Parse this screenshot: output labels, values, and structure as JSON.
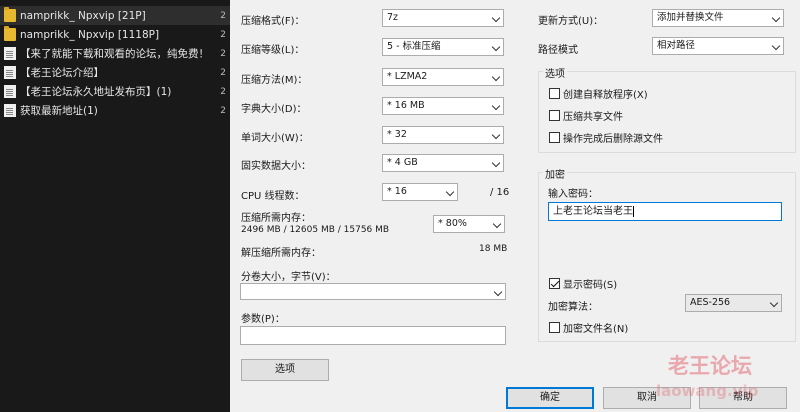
{
  "file_list": [
    {
      "name": "namprikk_ Npxvip [21P]",
      "extra": "2",
      "icon": "folder-icon"
    },
    {
      "name": "namprikk_ Npxvip [1118P]",
      "extra": "2",
      "icon": "folder-icon"
    },
    {
      "name": "【来了就能下载和观看的论坛，纯免费！",
      "extra": "2",
      "icon": "document-icon"
    },
    {
      "name": "【老王论坛介绍】",
      "extra": "2",
      "icon": "document-icon"
    },
    {
      "name": "【老王论坛永久地址发布页】(1)",
      "extra": "2",
      "icon": "document-icon"
    },
    {
      "name": "获取最新地址(1)",
      "extra": "2",
      "icon": "document-icon"
    }
  ],
  "form": {
    "archive_format_label": "压缩格式(F)：",
    "archive_format_value": "7z",
    "compression_level_label": "压缩等级(L)：",
    "compression_level_value": "5 - 标准压缩",
    "compression_method_label": "压缩方法(M)：",
    "compression_method_value": "* LZMA2",
    "dictionary_size_label": "字典大小(D)：",
    "dictionary_size_value": "* 16 MB",
    "word_size_label": "单词大小(W)：",
    "word_size_value": "* 32",
    "solid_block_label": "固实数据大小：",
    "solid_block_value": "* 4 GB",
    "cpu_threads_label": "CPU 线程数：",
    "cpu_threads_value": "* 16",
    "cpu_threads_total": "/ 16",
    "memory_compress_label": "压缩所需内存：",
    "memory_compress_detail": "2496 MB / 12605 MB / 15756 MB",
    "memory_percent_value": "* 80%",
    "memory_decompress_label": "解压缩所需内存：",
    "memory_decompress_value": "18 MB",
    "split_volume_label": "分卷大小，字节(V)：",
    "parameters_label": "参数(P)：",
    "options_button": "选项"
  },
  "right": {
    "update_mode_label": "更新方式(U)：",
    "update_mode_value": "添加并替换文件",
    "path_mode_label": "路径模式",
    "path_mode_value": "相对路径",
    "options_group_title": "选项",
    "opt_sfx": "创建自释放程序(X)",
    "opt_shared": "压缩共享文件",
    "opt_delete": "操作完成后删除源文件",
    "encryption_group_title": "加密",
    "password_label": "输入密码：",
    "password_value": "上老王论坛当老王",
    "show_password": "显示密码(S)",
    "encryption_method_label": "加密算法：",
    "encryption_method_value": "AES-256",
    "encrypt_filenames": "加密文件名(N)"
  },
  "buttons": {
    "ok": "确定",
    "cancel": "取消",
    "help": "帮助"
  },
  "watermark": {
    "line1": "老王论坛",
    "line2": "laowang.vip"
  }
}
